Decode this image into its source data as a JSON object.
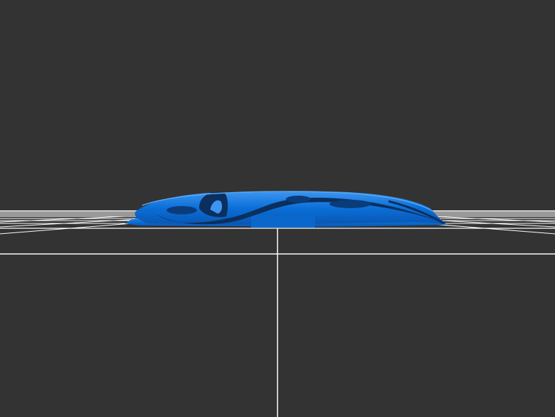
{
  "viewport": {
    "background_color": "#333333",
    "grid_color": "#ffffff",
    "grid_visible": true,
    "model_color": "#0a63c9",
    "model_shadow_color": "#0b3c7a",
    "model_highlight_color": "#3d95f0"
  }
}
